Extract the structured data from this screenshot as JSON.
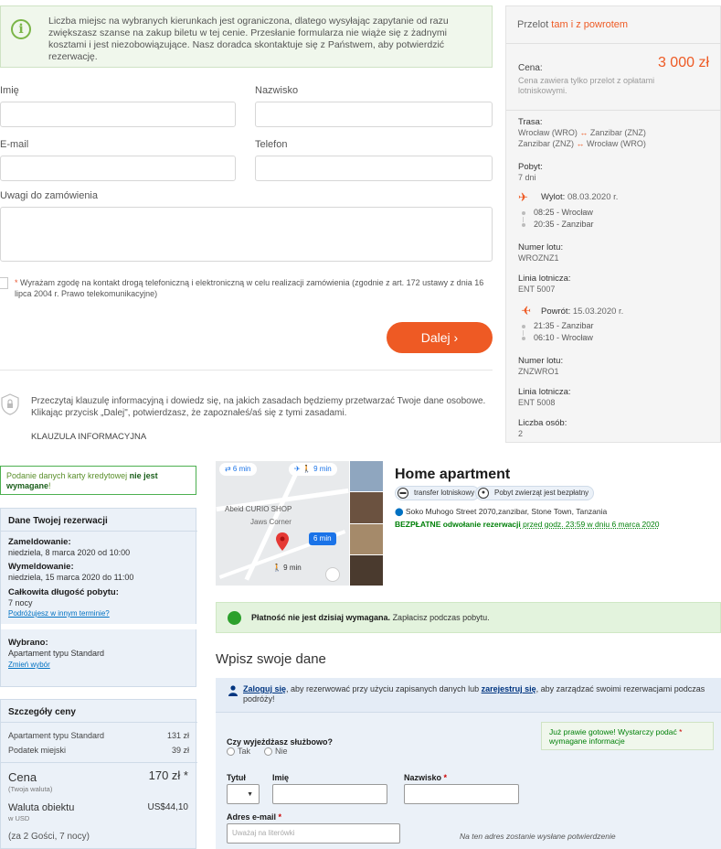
{
  "top_form": {
    "info_text": "Liczba miejsc na wybranych kierunkach jest ograniczona, dlatego wysyłając zapytanie od razu zwiększasz szanse na zakup biletu w tej cenie. Przesłanie formularza nie wiąże się z żadnymi kosztami i jest niezobowiązujące. Nasz doradca skontaktuje się z Państwem, aby potwierdzić rezerwację.",
    "first_name_label": "Imię",
    "last_name_label": "Nazwisko",
    "email_label": "E-mail",
    "phone_label": "Telefon",
    "notes_label": "Uwagi do zamówienia",
    "consent_star": "*",
    "consent_text": "Wyrażam zgodę na kontakt drogą telefoniczną i elektroniczną w celu realizacji zamówienia (zgodnie z art. 172 ustawy z dnia 16 lipca 2004 r. Prawo telekomunikacyjne)",
    "next_button": "Dalej  ›",
    "privacy_text": "Przeczytaj klauzulę informacyjną i dowiedz się, na jakich zasadach będziemy przetwarzać Twoje dane osobowe. Klikając przycisk „Dalej\", potwierdzasz, że zapoznałeś/aś się z tymi zasadami.",
    "privacy_link": "KLAUZULA INFORMACYJNA"
  },
  "flight_card": {
    "header_prefix": "Przelot ",
    "header_tam": "tam",
    "header_i": " i ",
    "header_powrotem": "z powrotem",
    "price_label": "Cena:",
    "price": "3 000 zł",
    "price_note": "Cena zawiera tylko przelot z opłatami lotniskowymi.",
    "route_label": "Trasa:",
    "route_1a": "Wrocław (WRO) ",
    "route_1b": " Zanzibar (ZNZ)",
    "route_2a": "Zanzibar (ZNZ) ",
    "route_2b": " Wrocław (WRO)",
    "arrow": "↔",
    "stay_label": "Pobyt:",
    "stay_value": "7 dni",
    "outbound_label": "Wylot:",
    "outbound_date": " 08.03.2020 r.",
    "outbound_t1": "08:25 - Wrocław",
    "outbound_t2": "20:35 - Zanzibar",
    "flight_no_label": "Numer lotu:",
    "flight_no_out": "WROZNZ1",
    "airline_label": "Linia lotnicza:",
    "airline_out": "ENT 5007",
    "return_label": "Powrót:",
    "return_date": " 15.03.2020 r.",
    "return_t1": "21:35 - Zanzibar",
    "return_t2": "06:10 - Wrocław",
    "flight_no_ret": "ZNZWRO1",
    "airline_ret": "ENT 5008",
    "persons_label": "Liczba osób:",
    "persons_value": "2"
  },
  "booking": {
    "cc_notice_a": "Podanie danych karty kredytowej ",
    "cc_notice_b": "nie jest wymagane",
    "cc_notice_c": "!",
    "res_title": "Dane Twojej rezerwacji",
    "checkin_label": "Zameldowanie:",
    "checkin_value": "niedziela, 8 marca 2020 od 10:00",
    "checkout_label": "Wymeldowanie:",
    "checkout_value": "niedziela, 15 marca 2020 do 11:00",
    "duration_label": "Całkowita długość pobytu:",
    "duration_value": "7 nocy",
    "other_dates_link": "Podróżujesz w innym terminie?",
    "chosen_label": "Wybrano:",
    "chosen_value": "Apartament typu Standard",
    "change_link": "Zmień wybór",
    "price_title": "Szczegóły ceny",
    "price_rows": [
      {
        "label": "Apartament typu Standard",
        "value": "131 zł"
      },
      {
        "label": "Podatek miejski",
        "value": "39 zł"
      }
    ],
    "total_label": "Cena",
    "total_sub": "(Twoja waluta)",
    "total_value": "170 zł *",
    "currency_label": "Waluta obiektu",
    "currency_sub": "w USD",
    "currency_value": "US$44,10",
    "guests_note": "(za 2 Gości, 7 nocy)"
  },
  "map": {
    "pill_left": "⇄ 6 min",
    "pill_right": "✈  🚶 9 min",
    "poi_1": "Abeid CURIO SHOP",
    "poi_2": "Jaws Corner",
    "walk_badge": "6 min",
    "walk_label": "🚶 9 min"
  },
  "hotel": {
    "name": "Home apartment",
    "badge_1": "transfer lotniskowy",
    "badge_2": "Pobyt zwierząt jest bezpłatny",
    "address": "Soko Muhogo Street 2070,zanzibar, Stone Town, Tanzania",
    "cancel_bold": "BEZPŁATNE odwołanie rezerwacji",
    "cancel_rest": " przed godz. 23:59 w dniu 6 marca 2020",
    "pay_bold": "Płatność nie jest dzisiaj wymagana.",
    "pay_rest": " Zapłacisz podczas pobytu."
  },
  "guest_form": {
    "title": "Wpisz swoje dane",
    "login_link": "Zaloguj się",
    "login_mid": ", aby rezerwować przy użyciu zapisanych danych lub ",
    "register_link": "zarejestruj się",
    "login_end": ", aby zarządzać swoimi rezerwacjami podczas podróży!",
    "business_q": "Czy wyjeżdżasz służbowo?",
    "yes": "Tak",
    "no": "Nie",
    "ready_text": "Już prawie gotowe! Wystarczy podać ",
    "ready_star": "*",
    "ready_text2": " wymagane informacje",
    "title_label": "Tytuł",
    "first_name_label": "Imię",
    "last_name_label": "Nazwisko",
    "star": "*",
    "email_label": "Adres e-mail",
    "email_placeholder": "Uważaj na literówki",
    "email_note": "Na ten adres zostanie wysłane potwierdzenie"
  },
  "colors": {
    "accent": "#ee5a24",
    "link": "#0071c2",
    "green": "#008009"
  }
}
